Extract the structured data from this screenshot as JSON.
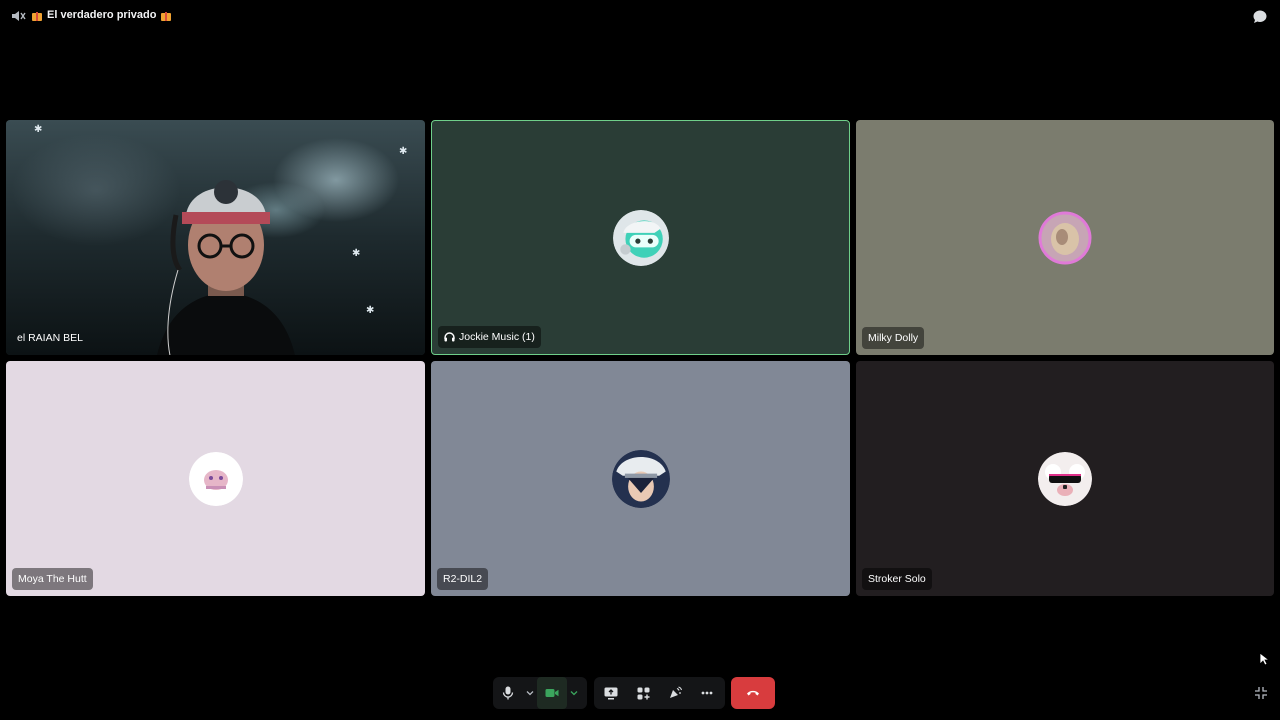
{
  "channel": {
    "title": "El verdadero privado",
    "icons": [
      "speaker-muted-icon",
      "gift-emoji",
      "gift-emoji",
      "chat-bubble-icon"
    ]
  },
  "participants": [
    {
      "name": "el RAIAN BEL",
      "tile": "camera-feed",
      "background": "#1a2629"
    },
    {
      "name": "Jockie Music (1)",
      "tile": "avatar",
      "background": "#2a3d36",
      "speaking": true,
      "badge_icon": "headphones-icon"
    },
    {
      "name": "Milky Dolly",
      "tile": "avatar",
      "background": "#7b7c6e"
    },
    {
      "name": "Moya The Hutt",
      "tile": "avatar",
      "background": "#e3d9e3"
    },
    {
      "name": "R2-DIL2",
      "tile": "avatar",
      "background": "#818896"
    },
    {
      "name": "Stroker Solo",
      "tile": "avatar",
      "background": "#221e20"
    }
  ],
  "controls": {
    "buttons": [
      "microphone-icon",
      "chevron-down-icon",
      "camera-icon",
      "chevron-down-icon",
      "screen-share-icon",
      "activities-icon",
      "soundboard-icon",
      "more-icon",
      "leave-call-icon"
    ],
    "camera_on": true,
    "leave_color": "#d83c3e",
    "camera_color": "#3ba55d",
    "speaking_ring_color": "#6fcf8a"
  }
}
